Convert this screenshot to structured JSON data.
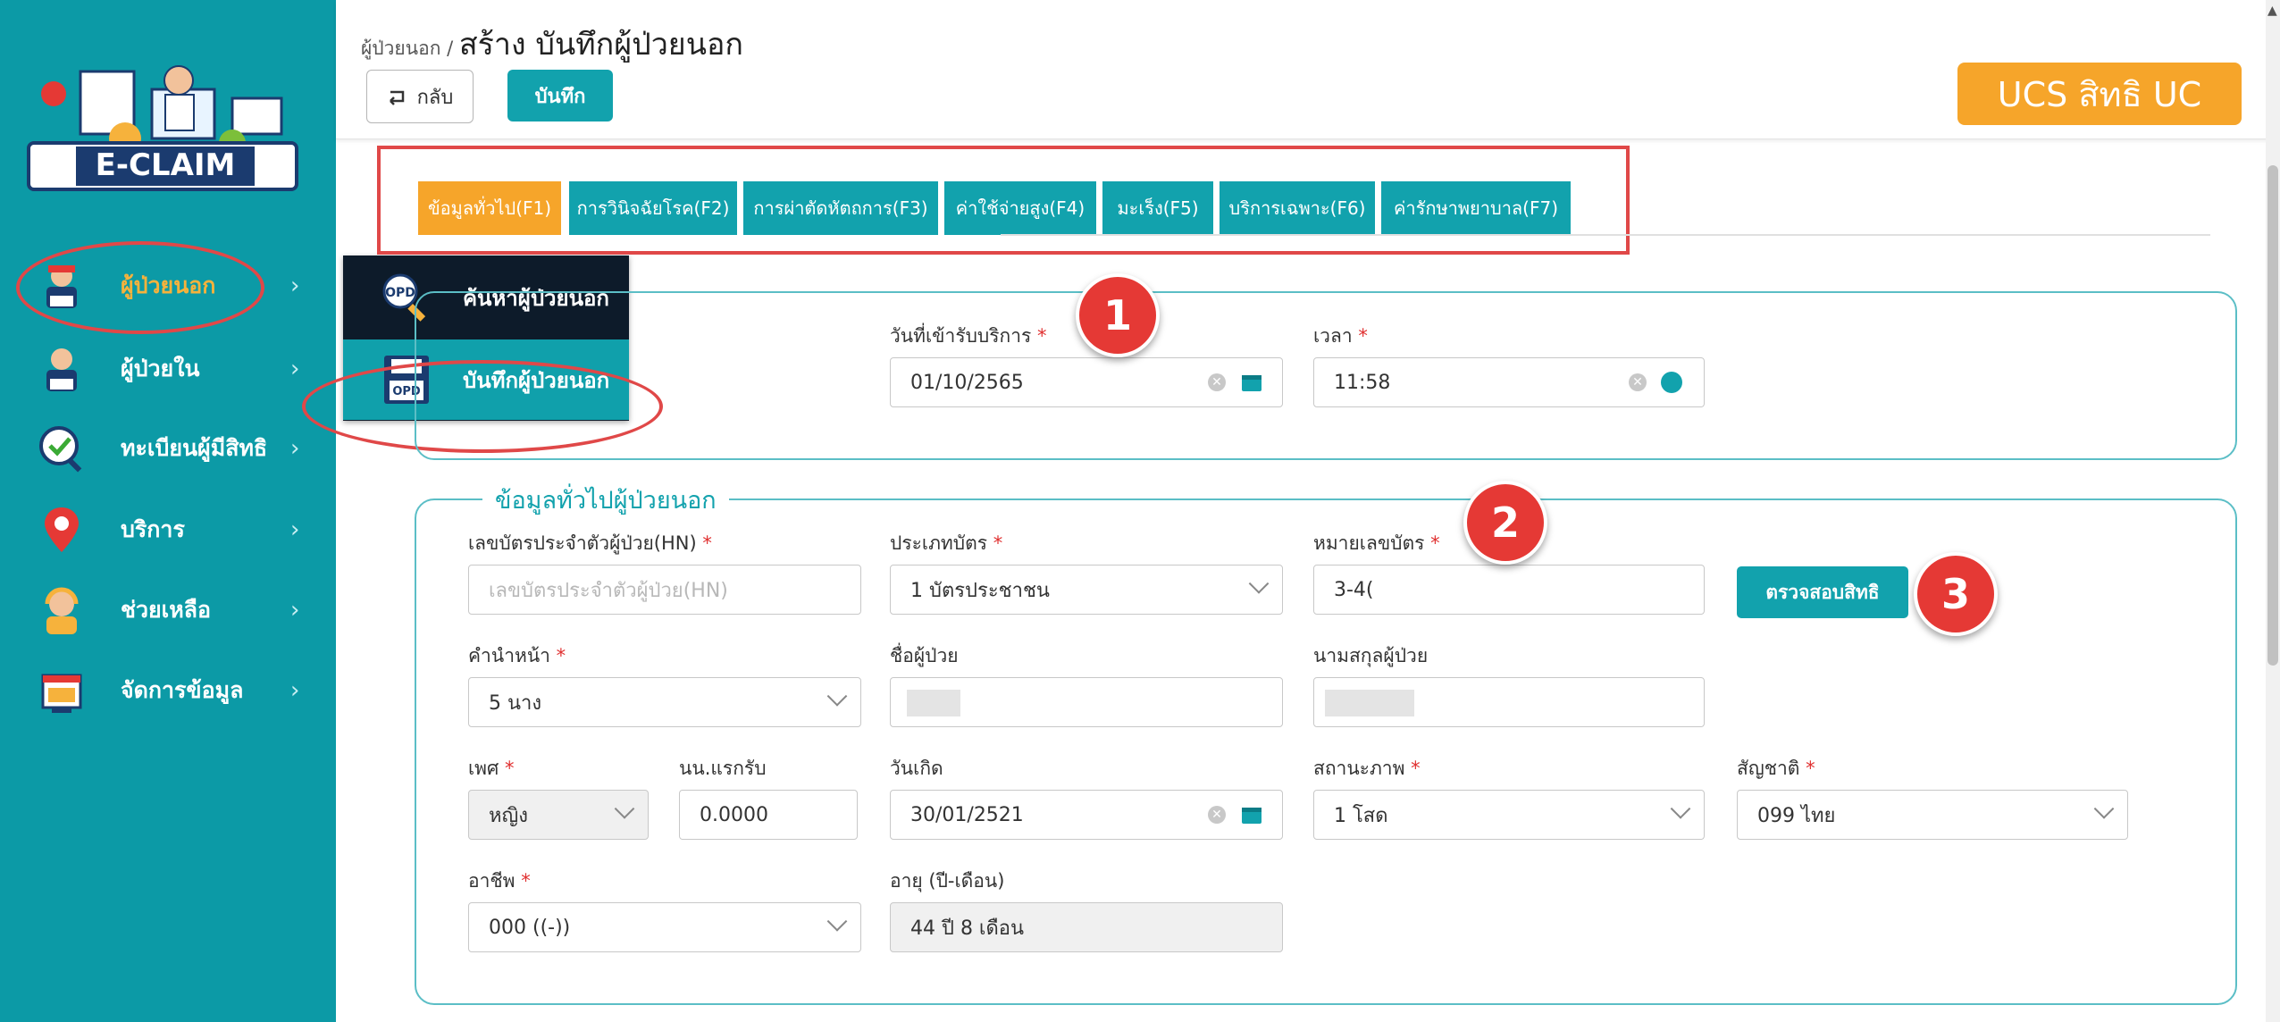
{
  "sidebar": {
    "logo_text": "E-CLAIM",
    "items": [
      {
        "label": "ผู้ป่วยนอก",
        "icon": "opd-patient-icon"
      },
      {
        "label": "ผู้ป่วยใน",
        "icon": "ipd-patient-icon"
      },
      {
        "label": "ทะเบียนผู้มีสิทธิ",
        "icon": "registry-check-icon"
      },
      {
        "label": "บริการ",
        "icon": "location-pin-icon"
      },
      {
        "label": "ช่วยเหลือ",
        "icon": "support-agent-icon"
      },
      {
        "label": "จัดการข้อมูล",
        "icon": "data-management-icon"
      }
    ],
    "arrow": "›",
    "submenu": [
      {
        "label": "ค้นหาผู้ป่วยนอก",
        "icon": "opd-search-icon"
      },
      {
        "label": "บันทึกผู้ป่วยนอก",
        "icon": "opd-save-icon"
      }
    ]
  },
  "header": {
    "crumb_parent": "ผู้ป่วยนอก /",
    "crumb_title": "สร้าง บันทึกผู้ป่วยนอก",
    "back_label": "กลับ",
    "save_label": "บันทึก",
    "rights_badge": "UCS สิทธิ UC"
  },
  "tabs": [
    {
      "label": "ข้อมูลทั่วไป(F1)",
      "active": true
    },
    {
      "label": "การวินิจฉัยโรค(F2)"
    },
    {
      "label": "การผ่าตัดหัตถการ(F3)"
    },
    {
      "label": "ค่าใช้จ่ายสูง(F4)"
    },
    {
      "label": "มะเร็ง(F5)"
    },
    {
      "label": "บริการเฉพาะ(F6)"
    },
    {
      "label": "ค่ารักษาพยาบาล(F7)"
    }
  ],
  "visit": {
    "date_label": "วันที่เข้ารับบริการ",
    "date_value": "01/10/2565",
    "time_label": "เวลา",
    "time_value": "11:58"
  },
  "general": {
    "legend": "ข้อมูลทั่วไปผู้ป่วยนอก",
    "hn_label": "เลขบัตรประจำตัวผู้ป่วย(HN)",
    "hn_placeholder": "เลขบัตรประจำตัวผู้ป่วย(HN)",
    "cardtype_label": "ประเภทบัตร",
    "cardtype_value": "1 บัตรประชาชน",
    "cardno_label": "หมายเลขบัตร",
    "cardno_value": "3-4(",
    "check_button": "ตรวจสอบสิทธิ",
    "prefix_label": "คำนำหน้า",
    "prefix_value": "5 นาง",
    "firstname_label": "ชื่อผู้ป่วย",
    "lastname_label": "นามสกุลผู้ป่วย",
    "sex_label": "เพศ",
    "sex_value": "หญิง",
    "weight_label": "นน.แรกรับ",
    "weight_value": "0.0000",
    "dob_label": "วันเกิด",
    "dob_value": "30/01/2521",
    "marital_label": "สถานะภาพ",
    "marital_value": "1 โสด",
    "nation_label": "สัญชาติ",
    "nation_value": "099 ไทย",
    "occupation_label": "อาชีพ",
    "occupation_value": "000 ((-))",
    "age_label": "อายุ (ปี-เดือน)",
    "age_value": "44 ปี 8 เดือน"
  },
  "callouts": [
    "1",
    "2",
    "3"
  ],
  "required_mark": "*"
}
